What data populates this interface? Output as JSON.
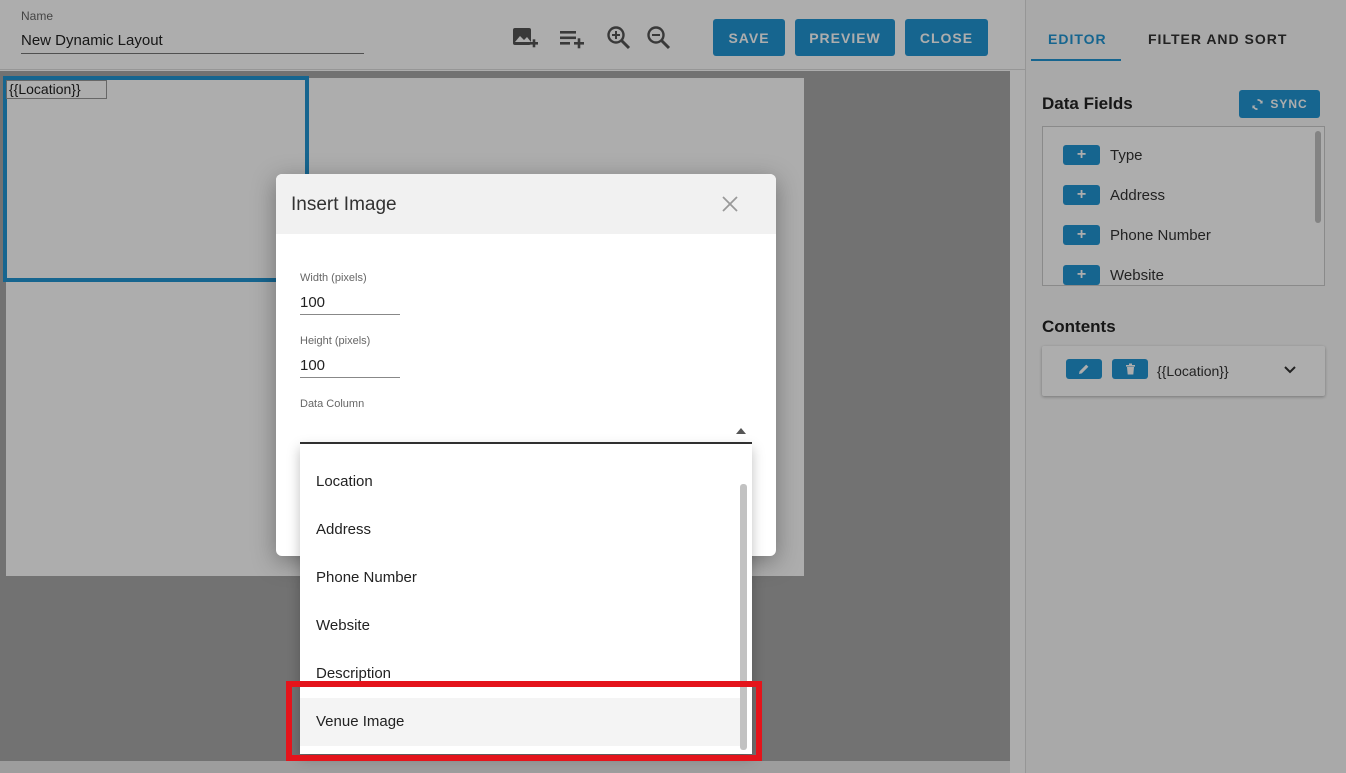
{
  "header": {
    "name_label": "Name",
    "name_value": "New Dynamic Layout",
    "toolbar_icons": [
      "add-image-icon",
      "add-row-icon",
      "zoom-in-icon",
      "zoom-out-icon"
    ],
    "save_label": "SAVE",
    "preview_label": "PREVIEW",
    "close_label": "CLOSE"
  },
  "canvas": {
    "location_placeholder": "{{Location}}"
  },
  "right_panel": {
    "tabs": [
      {
        "label": "EDITOR",
        "active": true
      },
      {
        "label": "FILTER AND SORT",
        "active": false
      }
    ],
    "data_fields_title": "Data Fields",
    "sync_label": "SYNC",
    "plus_label": "+",
    "data_fields": [
      "Type",
      "Address",
      "Phone Number",
      "Website"
    ],
    "contents_title": "Contents",
    "contents_item": "{{Location}}"
  },
  "modal": {
    "title": "Insert Image",
    "width_label": "Width (pixels)",
    "width_value": "100",
    "height_label": "Height (pixels)",
    "height_value": "100",
    "data_column_label": "Data Column",
    "data_column_value": "",
    "options": [
      "Location",
      "Address",
      "Phone Number",
      "Website",
      "Description",
      "Venue Image"
    ],
    "highlighted_option": "Venue Image"
  },
  "colors": {
    "accent": "#2196d3",
    "highlight": "#e4141b",
    "workarea": "#a8a8a8"
  }
}
